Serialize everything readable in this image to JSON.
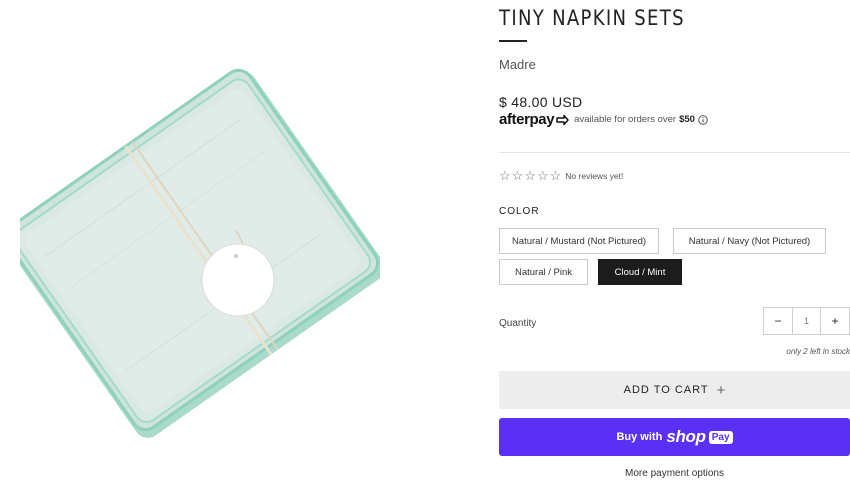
{
  "product": {
    "title": "TINY NAPKIN SETS",
    "vendor": "Madre",
    "price": "$ 48.00 USD"
  },
  "afterpay": {
    "logo": "afterpay",
    "text": "available for orders over",
    "amount": "$50",
    "icon": "info-icon"
  },
  "reviews": {
    "stars": [
      "☆",
      "☆",
      "☆",
      "☆",
      "☆"
    ],
    "text": "No reviews yet!"
  },
  "options": {
    "label": "COLOR",
    "values": [
      "Natural / Mustard (Not Pictured)",
      "Natural / Navy (Not Pictured)",
      "Natural / Pink",
      "Cloud / Mint"
    ],
    "selected": "Cloud / Mint"
  },
  "quantity": {
    "label": "Quantity",
    "minus": "−",
    "plus": "+",
    "value": "1",
    "stock": "only 2 left in stock"
  },
  "buttons": {
    "add_to_cart": "ADD TO CART",
    "add_icon": "+",
    "buy_with": "Buy with",
    "shop": "shop",
    "pay": "Pay",
    "more_options": "More payment options"
  },
  "colors": {
    "shop_pay": "#5a31f4",
    "selected_swatch": "#1c1c1c",
    "add_to_cart_bg": "#ededed"
  }
}
